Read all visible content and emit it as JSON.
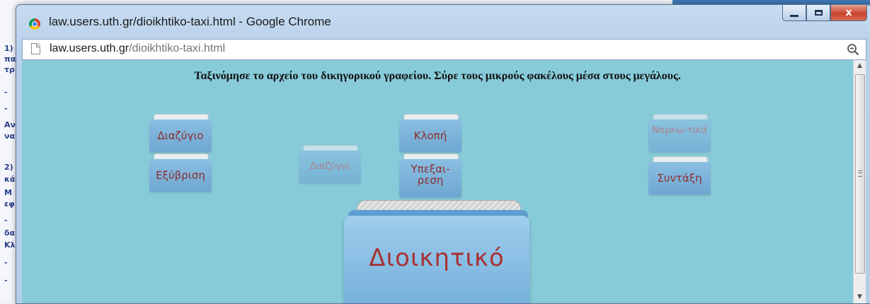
{
  "background": {
    "lines": [
      "1)",
      "πα",
      "τρ",
      "-",
      "-",
      "Aν",
      "να",
      "",
      "2)",
      "κά",
      "Μ",
      "εφ",
      "-",
      "δα",
      "Κλ",
      "-",
      "-"
    ]
  },
  "window": {
    "title": "law.users.uth.gr/dioikhtiko-taxi.html - Google Chrome",
    "controls": {
      "close": "x"
    }
  },
  "addressbar": {
    "host": "law.users.uth.gr",
    "path": "/dioikhtiko-taxi.html"
  },
  "page": {
    "instruction": "Ταξινόμησε το αρχείο του δικηγορικού γραφείου. Σύρε τους μικρούς φακέλους μέσα στους μεγάλους.",
    "folders": [
      {
        "label": "Διαζύγιο"
      },
      {
        "label": "Εξύβριση"
      },
      {
        "label": "Διαζύγιο"
      },
      {
        "label": "Κλοπή"
      },
      {
        "label": "Υπεξαι-ρεση"
      },
      {
        "label": "Ναρκω-τικά"
      },
      {
        "label": "Συντάξη"
      }
    ],
    "target_folder": {
      "label": "Διοικητικό"
    }
  },
  "colors": {
    "page_background": "#87cbd9",
    "folder_blue": "#72aedb",
    "folder_label": "#8c2f2f"
  }
}
